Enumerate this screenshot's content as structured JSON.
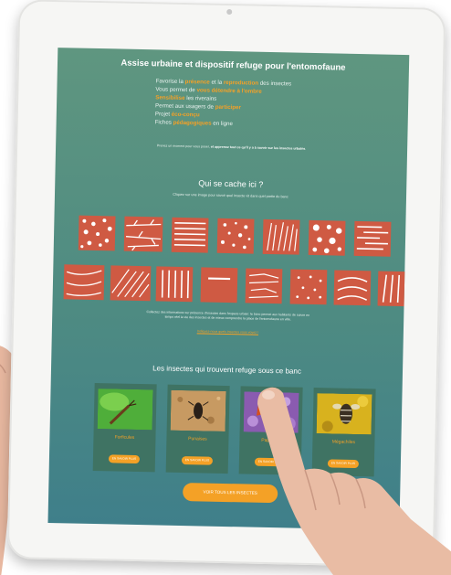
{
  "title": "Assise urbaine et dispositif refuge pour l'entomofaune",
  "bullets": [
    {
      "pre": "Favorise la ",
      "hl1": "présence",
      "mid": " et la ",
      "hl2": "reproduction",
      "post": " des insectes"
    },
    {
      "pre": "Vous permet de ",
      "hl1": "vous détendre à l'ombre",
      "mid": "",
      "hl2": "",
      "post": ""
    },
    {
      "pre": "",
      "hl1": "Sensibilise",
      "mid": " les riverains",
      "hl2": "",
      "post": ""
    },
    {
      "pre": "Permet aux usagers de ",
      "hl1": "participer",
      "mid": "",
      "hl2": "",
      "post": ""
    },
    {
      "pre": "Projet ",
      "hl1": "éco-conçu",
      "mid": "",
      "hl2": "",
      "post": ""
    },
    {
      "pre": "Fiches ",
      "hl1": "pédagogiques",
      "mid": " en ligne",
      "hl2": "",
      "post": ""
    }
  ],
  "intro": {
    "pre": "Prenez un moment pour vous poser, ",
    "bold": "et apprenez tout ce qu'il y a à savoir sur les insectes urbains",
    "post": "."
  },
  "section1": {
    "heading": "Qui se cache ici ?",
    "sub": "Cliquez sur une image pour savoir quel insecte vit dans quel partie du banc"
  },
  "paragraph": "Collectez des informations sur présence d'insectes dans l'espace urbain: le banc permet aux habitants de suivre en temps réel la vie des insectes et de mieux comprendre la place de l'entomofaune en ville.",
  "link": "Indiquez-nous quels insectes vous voyez !",
  "section2": {
    "heading": "Les insectes qui trouvent refuge sous ce banc"
  },
  "cards": [
    {
      "name": "Forficules",
      "button": "EN SAVOIR PLUS"
    },
    {
      "name": "Punaises",
      "button": "EN SAVOIR PLUS"
    },
    {
      "name": "Papillons",
      "button": "EN SAVOIR PLUS"
    },
    {
      "name": "Mégachiles",
      "button": "EN SAVOIR PLUS"
    }
  ],
  "all_button": "VOIR TOUS LES INSECTES",
  "colors": {
    "accent": "#f4a126",
    "tile": "#cf5a43",
    "screen": "#4e8b82",
    "card": "#3f7363"
  }
}
